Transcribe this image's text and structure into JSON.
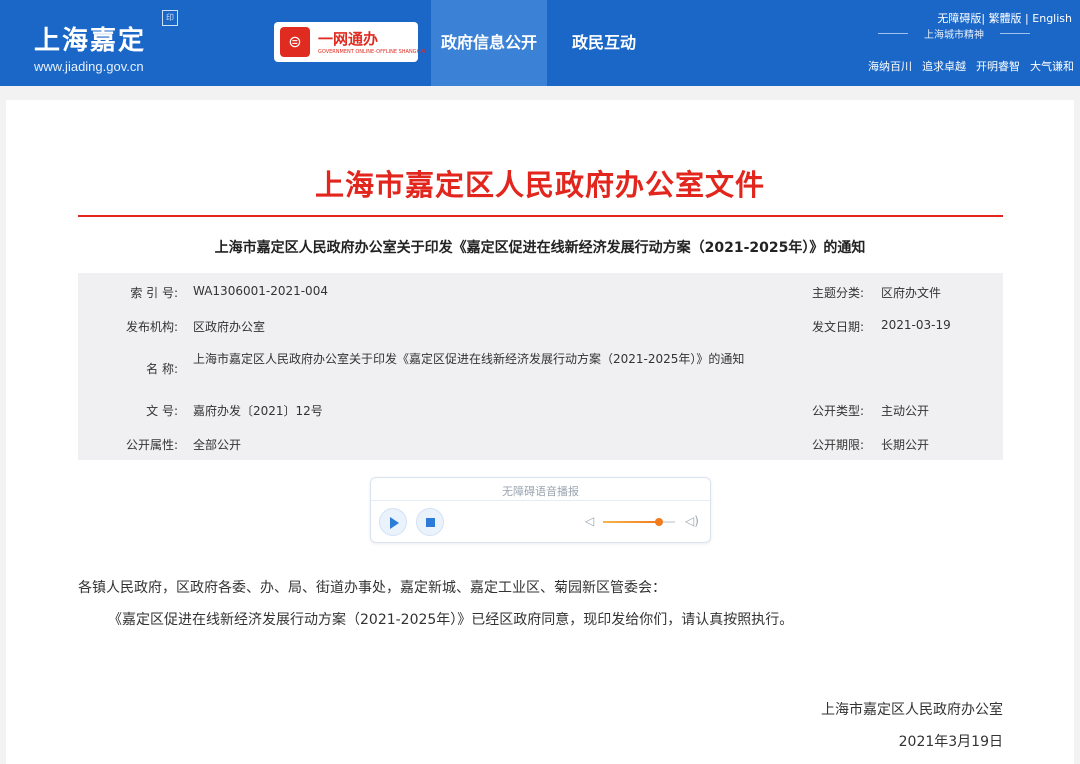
{
  "header": {
    "logo_text": "上海嘉定",
    "logo_stamp": "印",
    "logo_url": "www.jiading.gov.cn",
    "yiwang_label": "一网通办",
    "yiwang_sub": "GOVERNMENT ONLINE-OFFLINE SHANGHAI",
    "nav": [
      "政府信息公开",
      "政民互动"
    ],
    "links": {
      "accessible": "无障碍版",
      "traditional": "繁體版",
      "english": "English"
    },
    "spirit": "上海城市精神",
    "mottos": [
      "海纳百川",
      "追求卓越",
      "开明睿智",
      "大气谦和"
    ],
    "colors": {
      "brand": "#1a67c7",
      "active_nav": "#3b82d6"
    }
  },
  "document": {
    "title": "上海市嘉定区人民政府办公室文件",
    "subtitle": "上海市嘉定区人民政府办公室关于印发《嘉定区促进在线新经济发展行动方案（2021-2025年）》的通知",
    "title_color": "#e3261d"
  },
  "meta": {
    "index_label": "索 引 号:",
    "index_value": "WA1306001-2021-004",
    "topic_label": "主题分类:",
    "topic_value": "区府办文件",
    "issuer_label": "发布机构:",
    "issuer_value": "区政府办公室",
    "date_label": "发文日期:",
    "date_value": "2021-03-19",
    "name_label": "名 称:",
    "name_value": "上海市嘉定区人民政府办公室关于印发《嘉定区促进在线新经济发展行动方案（2021-2025年）》的通知",
    "docno_label": "文 号:",
    "docno_value": "嘉府办发〔2021〕12号",
    "pubtype_label": "公开类型:",
    "pubtype_value": "主动公开",
    "attr_label": "公开属性:",
    "attr_value": "全部公开",
    "period_label": "公开期限:",
    "period_value": "长期公开"
  },
  "audio": {
    "label": "无障碍语音播报",
    "volume_fraction": 0.78,
    "accent": "#2d7bd8"
  },
  "body": {
    "para1": "各镇人民政府，区政府各委、办、局、街道办事处，嘉定新城、嘉定工业区、菊园新区管委会：",
    "para2": "《嘉定区促进在线新经济发展行动方案（2021-2025年）》已经区政府同意，现印发给你们，请认真按照执行。",
    "sign_org": "上海市嘉定区人民政府办公室",
    "sign_date": "2021年3月19日"
  }
}
